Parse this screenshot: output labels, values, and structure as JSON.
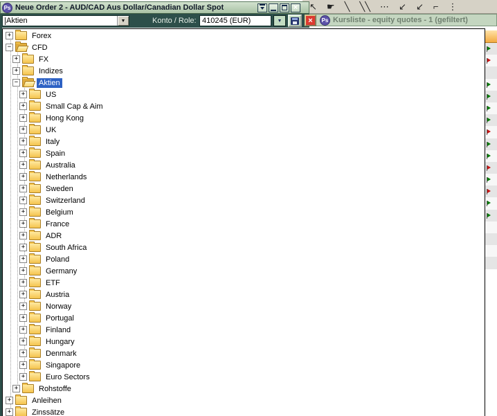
{
  "window": {
    "title": "Neue Order 2 - AUD/CAD Aus Dollar/Canadian Dollar Spot",
    "app_icon_text": "Ps"
  },
  "toolbar": {
    "instrument_combo_value": "Aktien",
    "account_label": "Konto / Role:",
    "account_combo_value": "410245 (EUR)"
  },
  "icons": {
    "dropdown_arrow": "▼",
    "close_x": "×"
  },
  "kursliste": {
    "title": "Kursliste - equity quotes - 1 (gefiltert)",
    "app_icon_text": "Ps"
  },
  "background_toolbar": {
    "icons": [
      {
        "name": "pointer-icon",
        "glyph": "↖"
      },
      {
        "name": "hand-icon",
        "glyph": "☛"
      },
      {
        "name": "line-icon",
        "glyph": "╲"
      },
      {
        "name": "double-line-icon",
        "glyph": "╲╲"
      },
      {
        "name": "dotted-line-icon",
        "glyph": "⋯"
      },
      {
        "name": "annotate-arrow-icon",
        "glyph": "↙"
      },
      {
        "name": "big-arrow-icon",
        "glyph": "↙"
      },
      {
        "name": "marker-icon",
        "glyph": "⌐"
      },
      {
        "name": "ruler-icon",
        "glyph": "⋮"
      }
    ]
  },
  "tree": {
    "rows": [
      {
        "label": "Forex",
        "depth": 0,
        "expanded": false,
        "open": false,
        "selected": false
      },
      {
        "label": "CFD",
        "depth": 0,
        "expanded": true,
        "open": true,
        "selected": false
      },
      {
        "label": "FX",
        "depth": 1,
        "expanded": false,
        "open": false,
        "selected": false
      },
      {
        "label": "Indizes",
        "depth": 1,
        "expanded": false,
        "open": false,
        "selected": false
      },
      {
        "label": "Aktien",
        "depth": 1,
        "expanded": true,
        "open": true,
        "selected": true
      },
      {
        "label": "US",
        "depth": 2,
        "expanded": false,
        "open": false,
        "selected": false
      },
      {
        "label": "Small Cap & Aim",
        "depth": 2,
        "expanded": false,
        "open": false,
        "selected": false
      },
      {
        "label": "Hong Kong",
        "depth": 2,
        "expanded": false,
        "open": false,
        "selected": false
      },
      {
        "label": "UK",
        "depth": 2,
        "expanded": false,
        "open": false,
        "selected": false
      },
      {
        "label": "Italy",
        "depth": 2,
        "expanded": false,
        "open": false,
        "selected": false
      },
      {
        "label": "Spain",
        "depth": 2,
        "expanded": false,
        "open": false,
        "selected": false
      },
      {
        "label": "Australia",
        "depth": 2,
        "expanded": false,
        "open": false,
        "selected": false
      },
      {
        "label": "Netherlands",
        "depth": 2,
        "expanded": false,
        "open": false,
        "selected": false
      },
      {
        "label": "Sweden",
        "depth": 2,
        "expanded": false,
        "open": false,
        "selected": false
      },
      {
        "label": "Switzerland",
        "depth": 2,
        "expanded": false,
        "open": false,
        "selected": false
      },
      {
        "label": "Belgium",
        "depth": 2,
        "expanded": false,
        "open": false,
        "selected": false
      },
      {
        "label": "France",
        "depth": 2,
        "expanded": false,
        "open": false,
        "selected": false
      },
      {
        "label": "ADR",
        "depth": 2,
        "expanded": false,
        "open": false,
        "selected": false
      },
      {
        "label": "South Africa",
        "depth": 2,
        "expanded": false,
        "open": false,
        "selected": false
      },
      {
        "label": "Poland",
        "depth": 2,
        "expanded": false,
        "open": false,
        "selected": false
      },
      {
        "label": "Germany",
        "depth": 2,
        "expanded": false,
        "open": false,
        "selected": false
      },
      {
        "label": "ETF",
        "depth": 2,
        "expanded": false,
        "open": false,
        "selected": false
      },
      {
        "label": "Austria",
        "depth": 2,
        "expanded": false,
        "open": false,
        "selected": false
      },
      {
        "label": "Norway",
        "depth": 2,
        "expanded": false,
        "open": false,
        "selected": false
      },
      {
        "label": "Portugal",
        "depth": 2,
        "expanded": false,
        "open": false,
        "selected": false
      },
      {
        "label": "Finland",
        "depth": 2,
        "expanded": false,
        "open": false,
        "selected": false
      },
      {
        "label": "Hungary",
        "depth": 2,
        "expanded": false,
        "open": false,
        "selected": false
      },
      {
        "label": "Denmark",
        "depth": 2,
        "expanded": false,
        "open": false,
        "selected": false
      },
      {
        "label": "Singapore",
        "depth": 2,
        "expanded": false,
        "open": false,
        "selected": false
      },
      {
        "label": "Euro Sectors",
        "depth": 2,
        "expanded": false,
        "open": false,
        "selected": false
      },
      {
        "label": "Rohstoffe",
        "depth": 1,
        "expanded": false,
        "open": false,
        "selected": false
      },
      {
        "label": "Anleihen",
        "depth": 0,
        "expanded": false,
        "open": false,
        "selected": false
      },
      {
        "label": "Zinssätze",
        "depth": 0,
        "expanded": false,
        "open": false,
        "selected": false
      }
    ]
  },
  "quote_strip": {
    "rows": [
      {
        "flag": "green"
      },
      {
        "flag": "red"
      },
      {
        "flag": "none"
      },
      {
        "flag": "green"
      },
      {
        "flag": "green"
      },
      {
        "flag": "green"
      },
      {
        "flag": "green"
      },
      {
        "flag": "red"
      },
      {
        "flag": "green"
      },
      {
        "flag": "green"
      },
      {
        "flag": "red"
      },
      {
        "flag": "green"
      },
      {
        "flag": "red"
      },
      {
        "flag": "green"
      },
      {
        "flag": "green"
      },
      {
        "flag": "none"
      },
      {
        "flag": "none"
      },
      {
        "flag": "none"
      },
      {
        "flag": "none"
      }
    ]
  }
}
